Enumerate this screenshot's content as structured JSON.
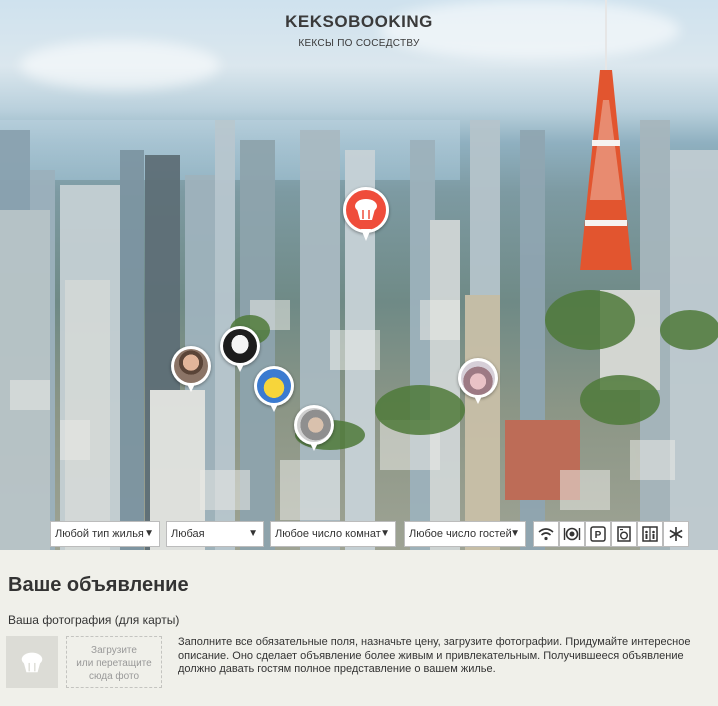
{
  "header": {
    "logo": "KEKSOBOOKING",
    "tagline": "КЕКСЫ ПО СОСЕДСТВУ"
  },
  "filters": {
    "type": "Любой тип жилья",
    "price": "Любая",
    "rooms": "Любое число комнат",
    "guests": "Любое число гостей",
    "features": [
      "wifi-icon",
      "dishwasher-icon",
      "parking-icon",
      "washer-icon",
      "elevator-icon",
      "conditioner-icon"
    ]
  },
  "form": {
    "title": "Ваше объявление",
    "photo_label": "Ваша фотография (для карты)",
    "dropzone_line1": "Загрузите",
    "dropzone_line2": "или перетащите",
    "dropzone_line3": "сюда фото",
    "hint": "Заполните все обязательные поля, назначьте цену, загрузите фотографии. Придумайте интересное описание. Оно сделает объявление более живым и привлекательным. Получившееся объявление должно давать гостям полное представление о вашем жилье."
  },
  "colors": {
    "accent": "#ef4d3b",
    "text": "#333333",
    "form_bg": "#f0f0ea"
  }
}
